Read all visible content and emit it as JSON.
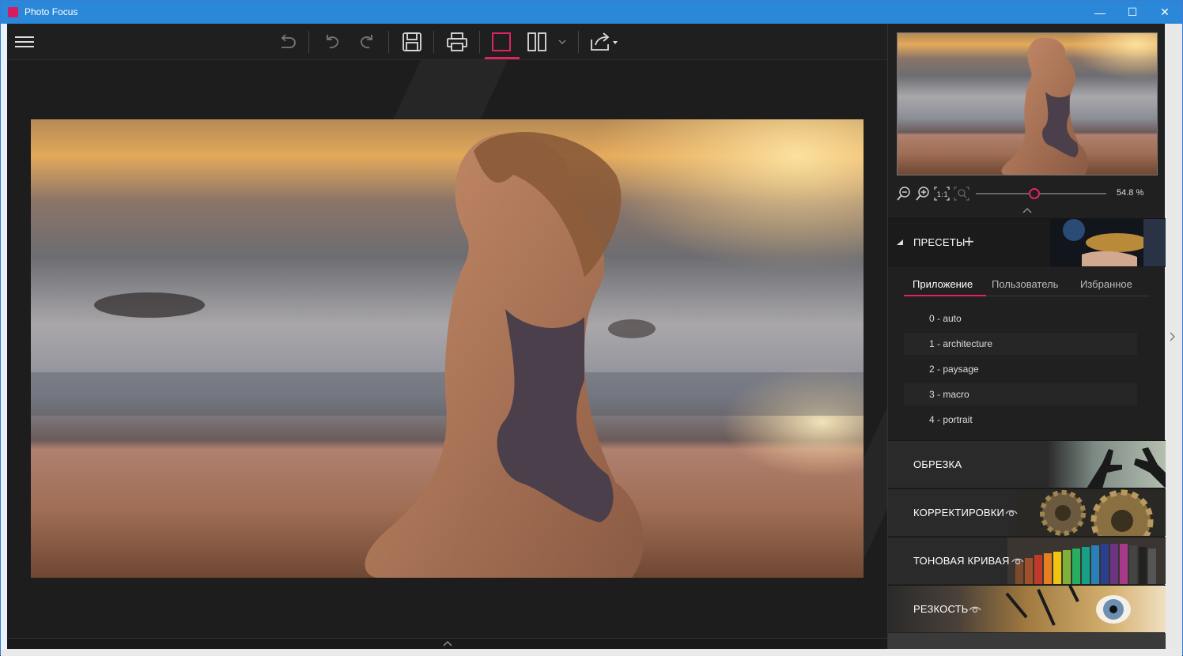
{
  "window": {
    "title": "Photo Focus",
    "controls": [
      "—",
      "☐",
      "✕"
    ]
  },
  "toolbar": {
    "items": [
      "menu-icon",
      "undo-all-icon",
      "undo-icon",
      "redo-icon",
      "save-icon",
      "print-icon",
      "single-view-icon",
      "split-view-icon",
      "view-dropdown-icon",
      "share-icon"
    ],
    "accent": "#e0245e"
  },
  "navigator": {
    "zoom_value": "54.8 %",
    "zoom_level": 0.45,
    "zoom_tools": [
      "zoom-out-icon",
      "zoom-in-icon",
      "zoom-1-1-icon",
      "zoom-fit-icon"
    ]
  },
  "presets": {
    "title": "ПРЕСЕТЫ",
    "add_label": "+",
    "tabs": [
      {
        "label": "Приложение",
        "active": true
      },
      {
        "label": "Пользователь",
        "active": false
      },
      {
        "label": "Избранное",
        "active": false
      }
    ],
    "items": [
      "0 - auto",
      "1 - architecture",
      "2 - paysage",
      "3 - macro",
      "4 - portrait"
    ]
  },
  "sections": [
    {
      "label": "ОБРЕЗКА",
      "eye": false
    },
    {
      "label": "КОРРЕКТИРОВКИ",
      "eye": true
    },
    {
      "label": "ТОНОВАЯ КРИВАЯ",
      "eye": true
    },
    {
      "label": "РЕЗКОСТЬ",
      "eye": true
    }
  ]
}
